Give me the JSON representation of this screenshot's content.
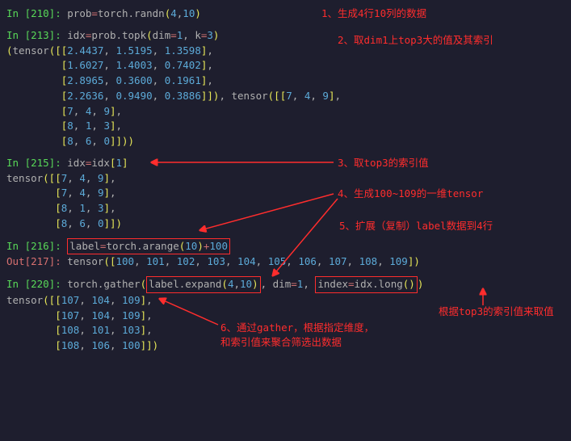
{
  "anno": {
    "a1": "1、生成4行10列的数据",
    "a2": "2、取dim1上top3大的值及其索引",
    "a3": "3、取top3的索引值",
    "a4": "4、生成100~109的一维tensor",
    "a5": "5、扩展（复制）label数据到4行",
    "a6a": "6、通过gather，根据指定维度，",
    "a6b": "和索引值来聚合筛选出数据",
    "a7": "根据top3的索引值来取值"
  },
  "p": {
    "in210": "In [210]: ",
    "in213": "In [213]: ",
    "in215": "In [215]: ",
    "in216": "In [216]: ",
    "out217": "Out[217]: ",
    "in220": "In [220]: "
  },
  "c": {
    "l210": "prob=torch.randn(4,10)",
    "l213": "idx=prob.topk(dim=1, k=3)",
    "r213a": "(tensor([[2.4437, 1.5195, 1.3598],",
    "r213b": "         [1.6027, 1.4003, 0.7402],",
    "r213c": "         [2.8965, 0.3600, 0.1961],",
    "r213d": "         [2.2636, 0.9490, 0.3886]]), tensor([[7, 4, 9],",
    "r213e": "         [7, 4, 9],",
    "r213f": "         [8, 1, 3],",
    "r213g": "         [8, 6, 0]]))",
    "l215": "idx=idx[1]",
    "r215a": "tensor([[7, 4, 9],",
    "r215b": "        [7, 4, 9],",
    "r215c": "        [8, 1, 3],",
    "r215d": "        [8, 6, 0]])",
    "l216a": "label=torch.arange(10)+100",
    "r217": "tensor([100, 101, 102, 103, 104, 105, 106, 107, 108, 109])",
    "l220a": "torch.gather(",
    "l220b": "label.expand(4,10)",
    "l220c": ", dim=1, ",
    "l220d": "index=idx.long()",
    "l220e": ")",
    "r220a": "tensor([[107, 104, 109],",
    "r220b": "        [107, 104, 109],",
    "r220c": "        [108, 101, 103],",
    "r220d": "        [108, 106, 100]])"
  }
}
